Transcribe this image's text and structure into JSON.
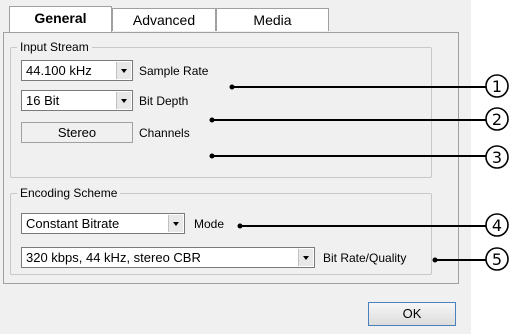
{
  "tabs": [
    {
      "label": "General",
      "active": true
    },
    {
      "label": "Advanced",
      "active": false
    },
    {
      "label": "Media",
      "active": false
    }
  ],
  "input_stream": {
    "title": "Input Stream",
    "sample_rate_value": "44.100 kHz",
    "sample_rate_label": "Sample Rate",
    "bit_depth_value": "16 Bit",
    "bit_depth_label": "Bit Depth",
    "channels_value": "Stereo",
    "channels_label": "Channels"
  },
  "encoding_scheme": {
    "title": "Encoding Scheme",
    "mode_value": "Constant Bitrate",
    "mode_label": "Mode",
    "quality_value": "320 kbps, 44 kHz, stereo CBR",
    "quality_label": "Bit Rate/Quality"
  },
  "ok_label": "OK",
  "callouts": [
    "1",
    "2",
    "3",
    "4",
    "5"
  ]
}
